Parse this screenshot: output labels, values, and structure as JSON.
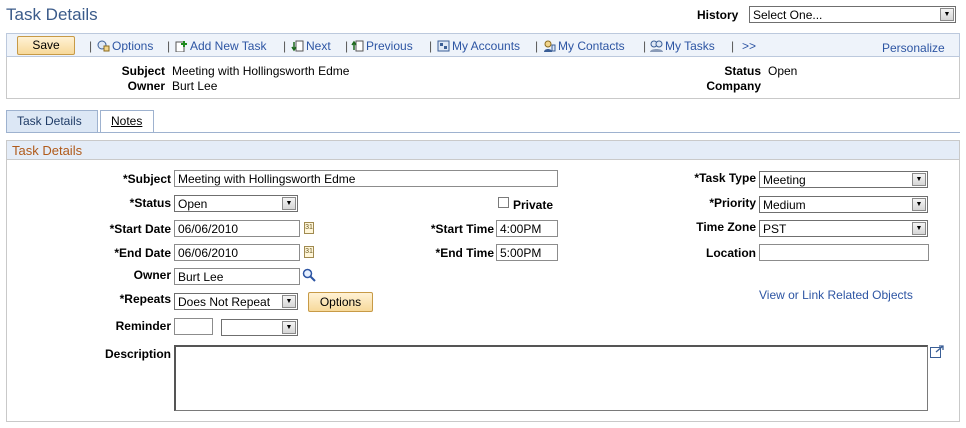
{
  "page": {
    "title": "Task Details"
  },
  "history": {
    "label": "History",
    "value": "Select One..."
  },
  "toolbar": {
    "save": "Save",
    "options": "Options",
    "add_new_task": "Add New Task",
    "next": "Next",
    "previous": "Previous",
    "my_accounts": "My Accounts",
    "my_contacts": "My Contacts",
    "my_tasks": "My Tasks",
    "more": ">>",
    "personalize": "Personalize"
  },
  "summary": {
    "subject_label": "Subject",
    "subject_value": "Meeting with Hollingsworth Edme",
    "owner_label": "Owner",
    "owner_value": "Burt Lee",
    "status_label": "Status",
    "status_value": "Open",
    "company_label": "Company"
  },
  "tabs": [
    {
      "label": "Task Details"
    },
    {
      "label": "Notes"
    }
  ],
  "form": {
    "section_title": "Task Details",
    "subject_label": "*Subject",
    "subject_value": "Meeting with Hollingsworth Edme",
    "status_label": "*Status",
    "status_value": "Open",
    "private_label": "Private",
    "start_date_label": "*Start Date",
    "start_date_value": "06/06/2010",
    "end_date_label": "*End Date",
    "end_date_value": "06/06/2010",
    "start_time_label": "*Start Time",
    "start_time_value": "4:00PM",
    "end_time_label": "*End Time",
    "end_time_value": "5:00PM",
    "owner_label": "Owner",
    "owner_value": "Burt Lee",
    "repeats_label": "*Repeats",
    "repeats_value": "Does Not Repeat",
    "options_button": "Options",
    "reminder_label": "Reminder",
    "description_label": "Description",
    "task_type_label": "*Task Type",
    "task_type_value": "Meeting",
    "priority_label": "*Priority",
    "priority_value": "Medium",
    "time_zone_label": "Time Zone",
    "time_zone_value": "PST",
    "location_label": "Location",
    "related_link": "View or Link Related Objects",
    "calendar_glyph": "31"
  }
}
